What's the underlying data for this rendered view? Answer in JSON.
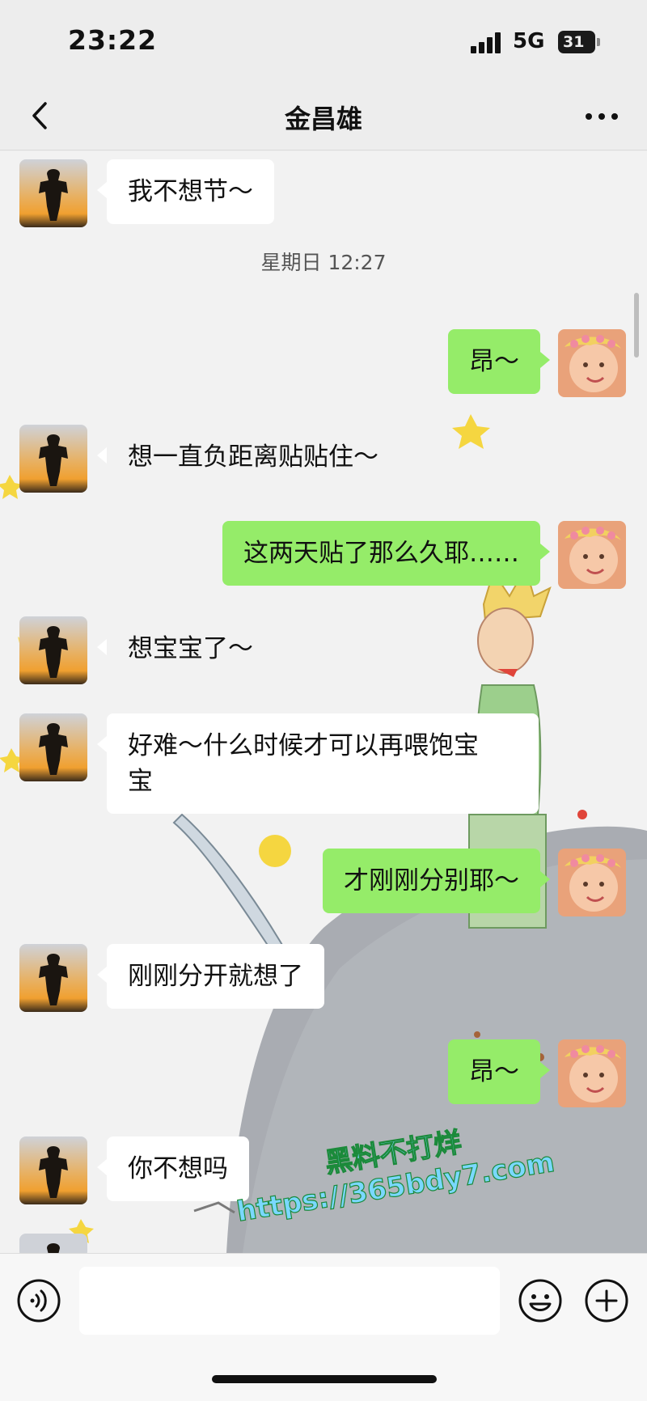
{
  "status_bar": {
    "time": "23:22",
    "network": "5G",
    "battery": "31"
  },
  "header": {
    "title": "金昌雄"
  },
  "messages": [
    {
      "side": "left",
      "text": "我不想节～"
    },
    {
      "timestamp": "星期日 12:27"
    },
    {
      "side": "right",
      "text": "昂～"
    },
    {
      "side": "left",
      "text": "想一直负距离贴贴住～"
    },
    {
      "side": "right",
      "text": "这两天贴了那么久耶……"
    },
    {
      "side": "left",
      "text": "想宝宝了～"
    },
    {
      "side": "left",
      "text_line1": "好难～什么时候才可以再喂饱宝",
      "text_line2": "宝"
    },
    {
      "side": "right",
      "text": "才刚刚分别耶～"
    },
    {
      "side": "left",
      "text": "刚刚分开就想了"
    },
    {
      "side": "right",
      "text": "昂～"
    },
    {
      "side": "left",
      "text": "你不想吗"
    }
  ],
  "watermark": {
    "line1": "黑料不打烊",
    "line2": "https://365bdy7.com"
  },
  "input_bar": {
    "value": ""
  },
  "icons": {
    "back": "chevron-left-icon",
    "more": "more-dots-icon",
    "voice": "voice-icon",
    "emoji": "emoji-icon",
    "plus": "plus-icon"
  },
  "colors": {
    "outgoing_bubble": "#95ec69",
    "incoming_bubble": "#ffffff",
    "background": "#ededed"
  }
}
